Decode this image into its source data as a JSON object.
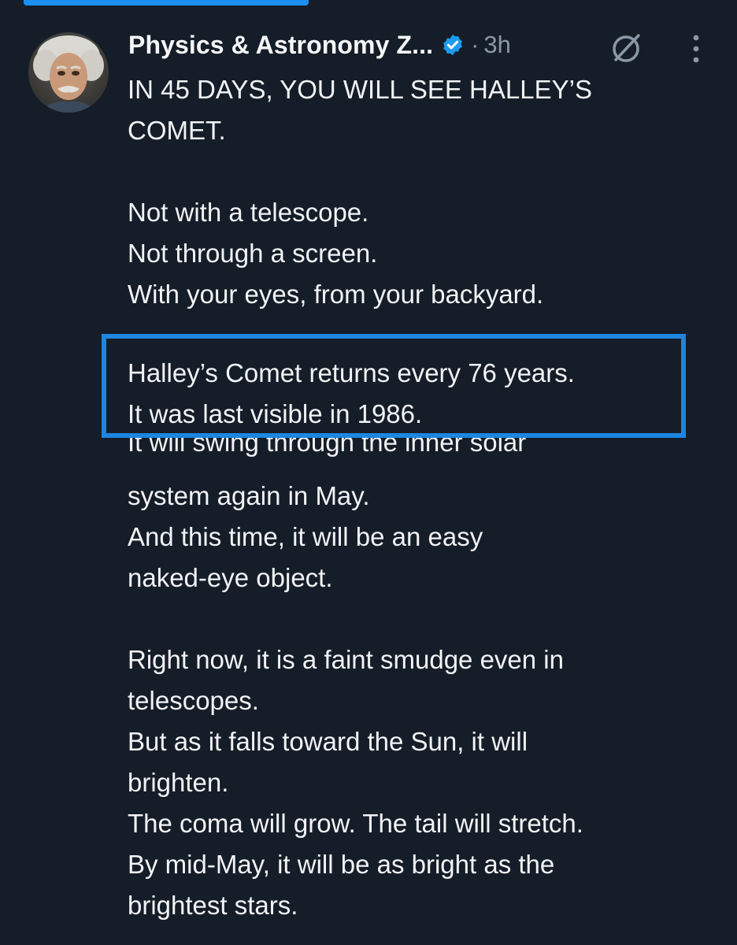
{
  "post": {
    "author_name": "Physics & Astronomy Z...",
    "separator": "·",
    "time": "3h",
    "icons": {
      "avatar": "avatar-portrait",
      "verified": "verified-badge-icon",
      "grok": "grok-icon",
      "more": "more-vertical-icon"
    },
    "colors": {
      "background": "#151d28",
      "accent": "#1d86e0",
      "muted": "#8b98a5"
    },
    "lines_top": [
      "IN 45 DAYS, YOU WILL SEE HALLEY’S",
      "COMET.",
      "",
      "Not with a telescope.",
      "Not through a screen.",
      "With your eyes, from your backyard."
    ],
    "highlighted": [
      "Halley’s Comet returns every 76 years.",
      "It was last visible in 1986."
    ],
    "partial_line": "It will swing through the inner solar",
    "lines_bottom": [
      "system again in May.",
      "And this time, it will be an easy",
      "naked-eye object.",
      "",
      "Right now, it is a faint smudge even in",
      "telescopes.",
      "But as it falls toward the Sun, it will",
      "brighten.",
      "The coma will grow. The tail will stretch.",
      "By mid-May, it will be as bright as the",
      "brightest stars."
    ]
  }
}
